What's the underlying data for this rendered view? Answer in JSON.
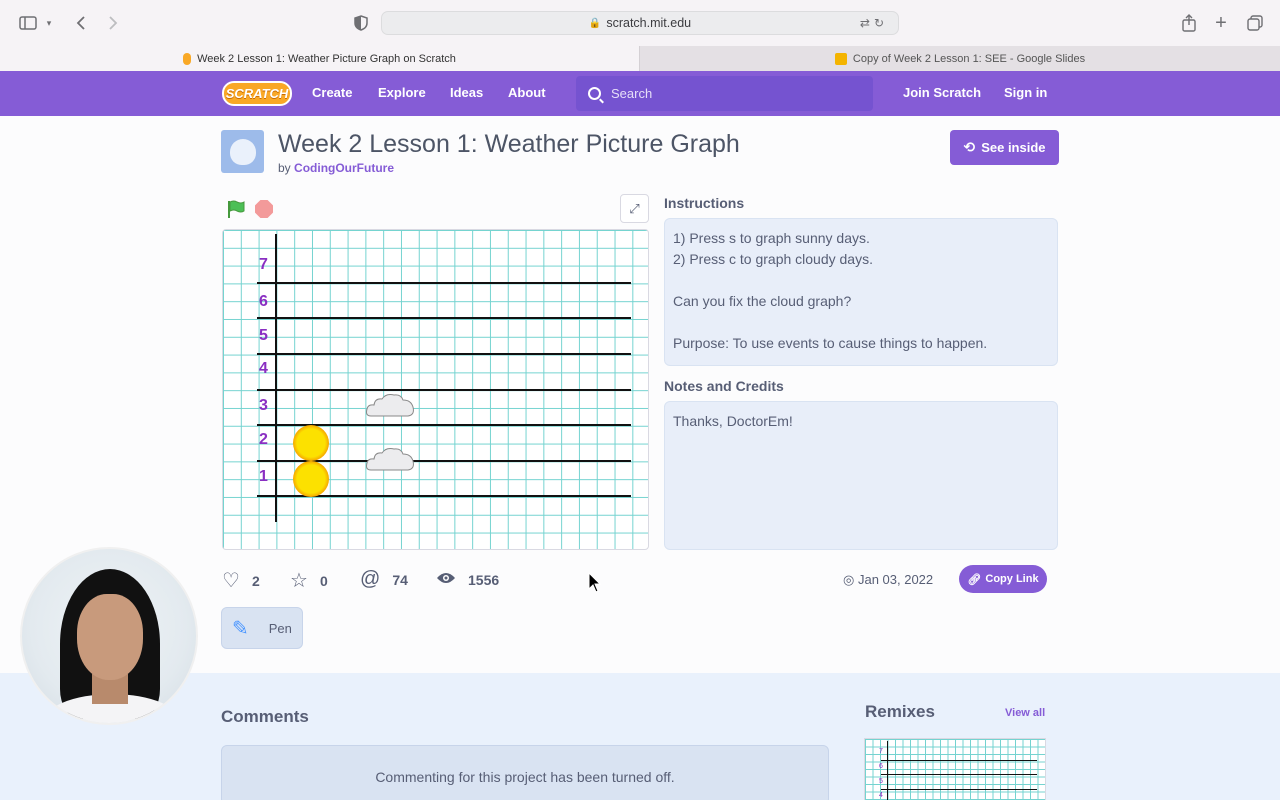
{
  "browser": {
    "url": "scratch.mit.edu",
    "tabs": [
      {
        "label": "Week 2 Lesson 1: Weather Picture Graph on Scratch",
        "active": true
      },
      {
        "label": "Copy of Week 2 Lesson 1: SEE - Google Slides",
        "active": false
      }
    ]
  },
  "nav": {
    "logo": "SCRATCH",
    "links": [
      "Create",
      "Explore",
      "Ideas",
      "About"
    ],
    "search_placeholder": "Search",
    "join": "Join Scratch",
    "signin": "Sign in",
    "color": "#855cd6"
  },
  "project": {
    "title": "Week 2 Lesson 1: Weather Picture Graph",
    "by": "by",
    "author": "CodingOurFuture",
    "see_inside": "See inside"
  },
  "stage": {
    "y_labels": [
      "7",
      "6",
      "5",
      "4",
      "3",
      "2",
      "1"
    ],
    "sunny_count": 2,
    "cloudy_count": 2
  },
  "instructions": {
    "heading": "Instructions",
    "lines": [
      "1) Press s to graph sunny days.",
      "2) Press c to graph cloudy days.",
      "",
      "Can you fix the cloud graph?",
      "",
      "Purpose: To use events to cause things to happen."
    ]
  },
  "notes": {
    "heading": "Notes and Credits",
    "text": "Thanks, DoctorEm!"
  },
  "stats": {
    "loves": "2",
    "favorites": "0",
    "remixes": "74",
    "views": "1556"
  },
  "shared_date": "Jan 03, 2022",
  "copy_link": "Copy Link",
  "extension": "Pen",
  "comments": {
    "heading": "Comments",
    "disabled_text": "Commenting for this project has been turned off."
  },
  "remixes": {
    "heading": "Remixes",
    "view_all": "View all",
    "thumb_labels": [
      "7",
      "6",
      "5",
      "4"
    ]
  }
}
